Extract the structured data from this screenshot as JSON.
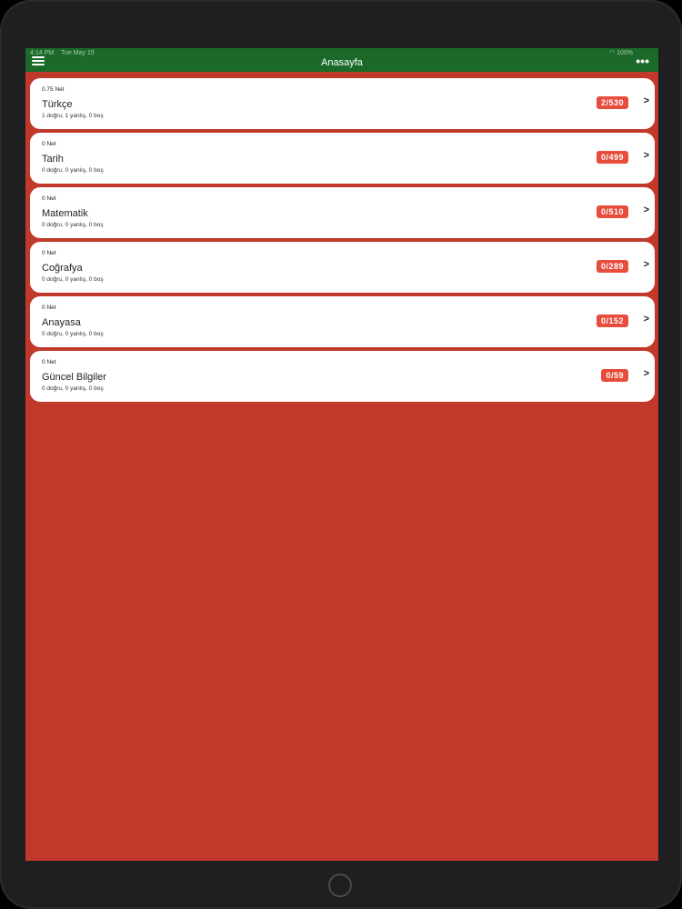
{
  "status_bar": {
    "time": "4:14 PM",
    "date": "Tue May 15",
    "battery": "100%"
  },
  "navbar": {
    "title": "Anasayfa",
    "menu_icon": "hamburger-menu-icon",
    "more_icon": "more-dots-icon",
    "more_label": "•••"
  },
  "colors": {
    "navbar": "#1b6a2a",
    "background": "#c0392b",
    "badge": "#e74c3c",
    "card": "#ffffff"
  },
  "subjects": [
    {
      "net": "0.75 Net",
      "name": "Türkçe",
      "stats": "1 doğru, 1 yanlış, 0 boş",
      "progress": "2/530",
      "chevron": ">"
    },
    {
      "net": "0 Net",
      "name": "Tarih",
      "stats": "0 doğru, 0 yanlış, 0 boş",
      "progress": "0/499",
      "chevron": ">"
    },
    {
      "net": "0 Net",
      "name": "Matematik",
      "stats": "0 doğru, 0 yanlış, 0 boş",
      "progress": "0/510",
      "chevron": ">"
    },
    {
      "net": "0 Net",
      "name": "Coğrafya",
      "stats": "0 doğru, 0 yanlış, 0 boş",
      "progress": "0/289",
      "chevron": ">"
    },
    {
      "net": "0 Net",
      "name": "Anayasa",
      "stats": "0 doğru, 0 yanlış, 0 boş",
      "progress": "0/152",
      "chevron": ">"
    },
    {
      "net": "0 Net",
      "name": "Güncel Bilgiler",
      "stats": "0 doğru, 0 yanlış, 0 boş",
      "progress": "0/59",
      "chevron": ">"
    }
  ]
}
